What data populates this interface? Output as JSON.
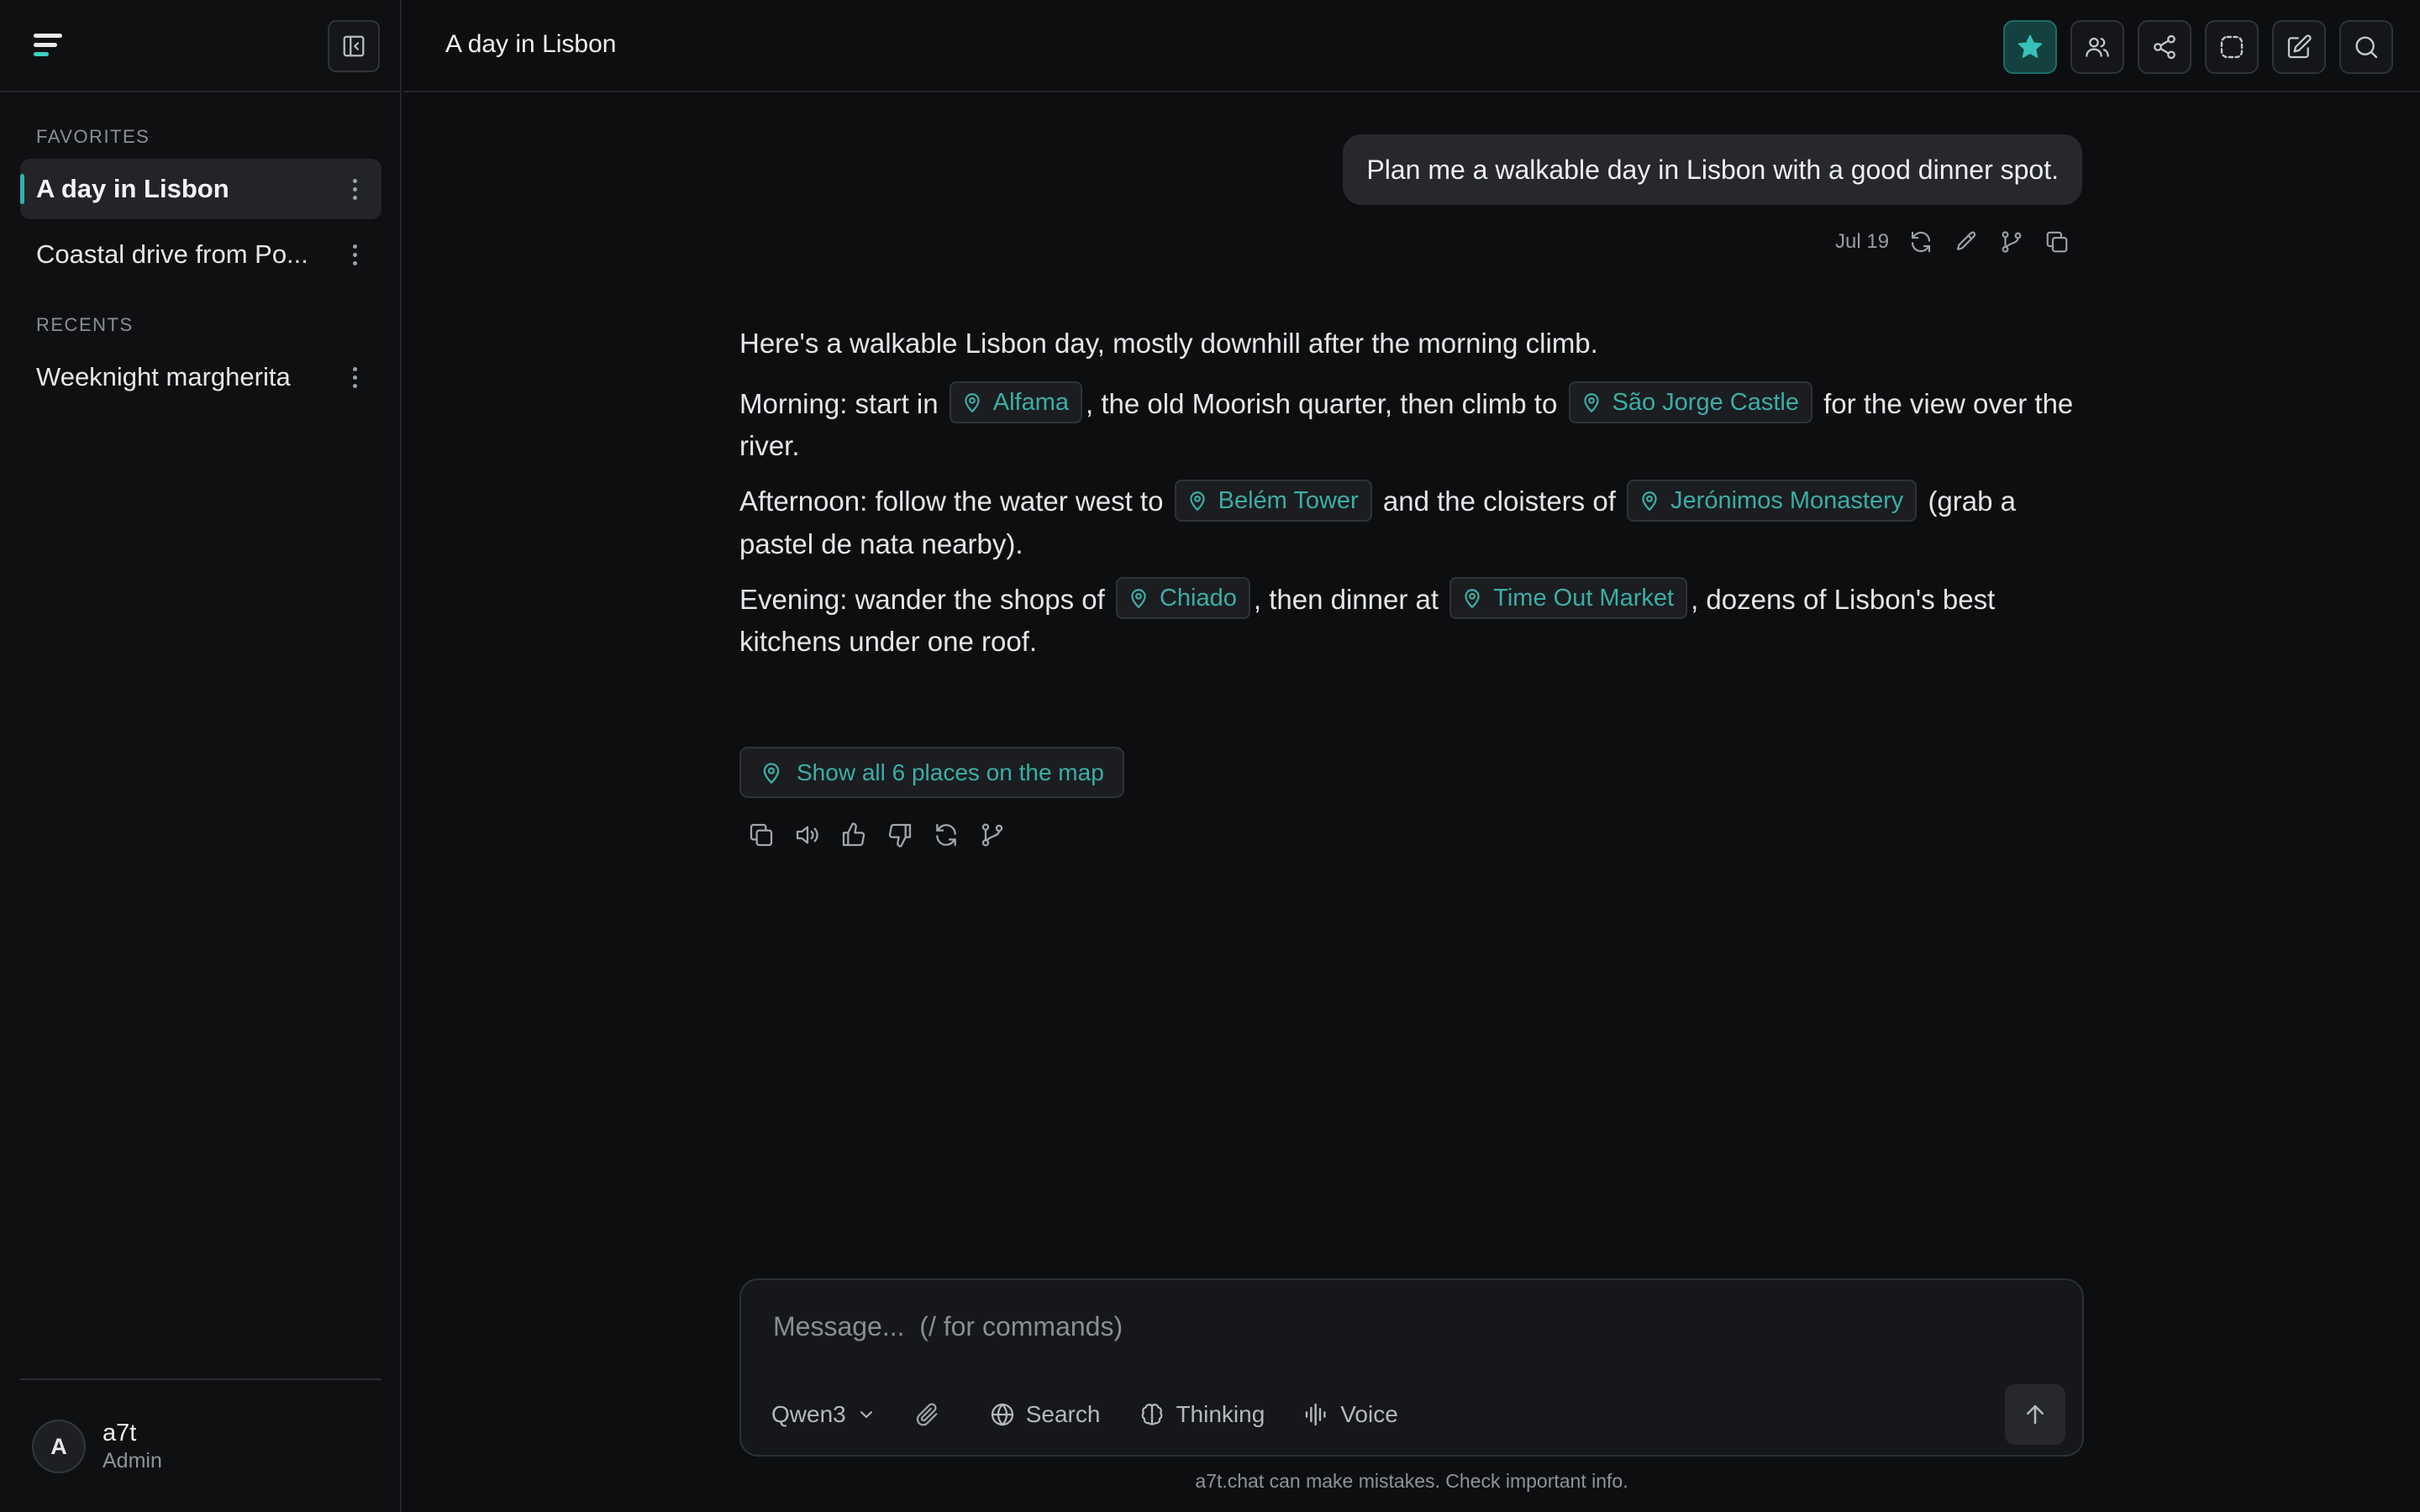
{
  "sidebar": {
    "favorites_label": "FAVORITES",
    "recents_label": "RECENTS",
    "favorites": [
      {
        "label": "A day in Lisbon",
        "active": true
      },
      {
        "label": "Coastal drive from Po..."
      }
    ],
    "recents": [
      {
        "label": "Weeknight margherita"
      }
    ],
    "user": {
      "initial": "A",
      "name": "a7t",
      "role": "Admin"
    }
  },
  "header": {
    "title": "A day in Lisbon",
    "icons": [
      "star-icon",
      "users-icon",
      "share-icon",
      "selection-icon",
      "edit-icon",
      "search-icon"
    ]
  },
  "chat": {
    "user_message": "Plan me a walkable day in Lisbon with a good dinner spot.",
    "user_message_date": "Jul 19",
    "answer": {
      "intro": "Here's a walkable Lisbon day, mostly downhill after the morning climb.",
      "morning": {
        "pre": "Morning: start in",
        "place1": "Alfama",
        "mid": ", the old Moorish quarter, then climb to",
        "place2": "São Jorge Castle",
        "post": "for the view over the river."
      },
      "afternoon": {
        "pre": "Afternoon: follow the water west to",
        "place1": "Belém Tower",
        "mid": "and the cloisters of",
        "place2": "Jerónimos Monastery",
        "post": "(grab a pastel de nata nearby)."
      },
      "evening": {
        "pre": "Evening: wander the shops of",
        "place1": "Chiado",
        "mid": ", then dinner at",
        "place2": "Time Out Market",
        "post": ", dozens of Lisbon's best kitchens under one roof."
      },
      "map_button": "Show all 6 places on the map"
    }
  },
  "composer": {
    "placeholder": "Message...  (/ for commands)",
    "model": "Qwen3",
    "search_label": "Search",
    "thinking_label": "Thinking",
    "voice_label": "Voice"
  },
  "footer": {
    "disclaimer": "a7t.chat can make mistakes. Check important info."
  },
  "colors": {
    "accent": "#3aaea6",
    "background": "#0d0e10",
    "favorite_active": "#14413f"
  }
}
